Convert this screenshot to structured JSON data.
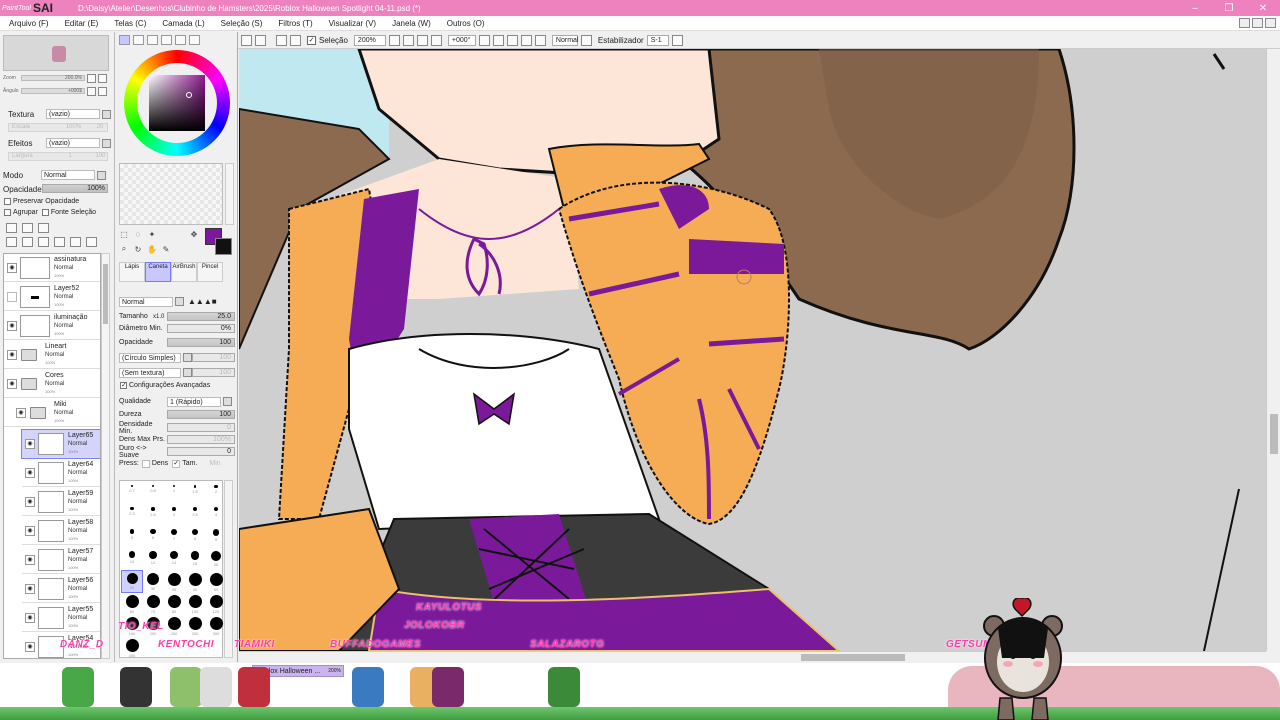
{
  "titlebar": {
    "logo_small": "PaintTool",
    "logo_big": "SAI",
    "title": "D:\\Daisy\\Atelier\\Desenhos\\Clubinho de Hamsters\\2025\\Roblox Halloween Spotlight 04-11.psd (*)",
    "min": "–",
    "max": "❐",
    "close": "✕"
  },
  "menu": {
    "items": [
      "Arquivo (F)",
      "Editar (E)",
      "Telas (C)",
      "Camada (L)",
      "Seleção (S)",
      "Filtros (T)",
      "Visualizar (V)",
      "Janela (W)",
      "Outros (O)"
    ]
  },
  "left": {
    "zoom_label": "Zoom",
    "zoom_value": "200.0%",
    "angle_label": "Ângulo",
    "angle_value": "+000$",
    "texture_label": "Textura",
    "texture_value": "(vazio)",
    "escala_label": "Escala",
    "escala_value": "100%",
    "escala_num": "20",
    "effects_label": "Efeitos",
    "effects_value": "(vazio)",
    "largura_label": "Largura",
    "largura_a": "1",
    "largura_b": "100",
    "mode_label": "Modo",
    "mode_value": "Normal",
    "opacity_label": "Opacidade",
    "opacity_value": "100%",
    "preserve_label": "Preservar Opacidade",
    "group_label": "Agrupar",
    "source_label": "Fonte Seleção"
  },
  "layers": [
    {
      "name": "assinatura",
      "mode": "Normal",
      "op": "100%",
      "type": "layer"
    },
    {
      "name": "Layer52",
      "mode": "Normal",
      "op": "100%",
      "type": "layer"
    },
    {
      "name": "iluminação",
      "mode": "Normal",
      "op": "100%",
      "type": "layer"
    },
    {
      "name": "Lineart",
      "mode": "Normal",
      "op": "100%",
      "type": "folder"
    },
    {
      "name": "Cores",
      "mode": "Normal",
      "op": "100%",
      "type": "folder"
    },
    {
      "name": "Miki",
      "mode": "Normal",
      "op": "100%",
      "type": "folder"
    },
    {
      "name": "Layer65",
      "mode": "Normal",
      "op": "100%",
      "type": "layer"
    },
    {
      "name": "Layer64",
      "mode": "Normal",
      "op": "100%",
      "type": "layer"
    },
    {
      "name": "Layer59",
      "mode": "Normal",
      "op": "100%",
      "type": "layer"
    },
    {
      "name": "Layer58",
      "mode": "Normal",
      "op": "100%",
      "type": "layer"
    },
    {
      "name": "Layer57",
      "mode": "Normal",
      "op": "100%",
      "type": "layer"
    },
    {
      "name": "Layer56",
      "mode": "Normal",
      "op": "100%",
      "type": "layer"
    },
    {
      "name": "Layer55",
      "mode": "Normal",
      "op": "100%",
      "type": "layer"
    },
    {
      "name": "Layer54",
      "mode": "Normal",
      "op": "100%",
      "type": "layer"
    }
  ],
  "tools": {
    "tabs": [
      "Lápis",
      "Caneta",
      "AirBrush",
      "Pincel"
    ],
    "blend_mode": "Normal",
    "size_label": "Tamanho",
    "size_mult": "x1.0",
    "size_value": "25.0",
    "min_diam_label": "Diâmetro Min.",
    "min_diam_value": "0%",
    "opacity_label": "Opacidade",
    "opacity_value": "100",
    "shape_value": "(Círculo Simples)",
    "shape_num": "100",
    "texture_value": "(Sem textura)",
    "texture_num": "100",
    "advanced_label": "Configurações Avançadas",
    "quality_label": "Qualidade",
    "quality_value": "1 (Rápido)",
    "hardness_label": "Dureza",
    "hardness_value": "100",
    "min_density_label": "Densidade Min.",
    "min_density_value": "0",
    "max_dens_label": "Dens Max Prs.",
    "max_dens_value": "100%",
    "hard_soft_label": "Duro <-> Suave",
    "hard_soft_value": "0",
    "press_label": "Press:",
    "dens_label": "Dens",
    "tam_label": "Tam.",
    "min_label": "Min"
  },
  "brush_sizes": [
    "0.7",
    "0.8",
    "1",
    "1.5",
    "2",
    "2.3",
    "2.6",
    "3",
    "3.5",
    "4",
    "5",
    "6",
    "7",
    "8",
    "9",
    "10",
    "12",
    "14",
    "16",
    "20",
    "25",
    "30",
    "35",
    "40",
    "50",
    "60",
    "70",
    "80",
    "100",
    "120",
    "160",
    "200",
    "250",
    "300",
    "350",
    "400"
  ],
  "toolbar2": {
    "selection_label": "Seleção",
    "zoom": "200%",
    "angle": "+000°",
    "blend": "Normal",
    "stabilizer_label": "Estabilizador",
    "stabilizer_value": "S-1"
  },
  "docbar": {
    "tab_label": "Roblox Halloween ...",
    "tab_zoom": "200%"
  },
  "overlay_names": [
    "DANZ_D",
    "TIO_KEL",
    "KENTOCHI",
    "TIAMIKI",
    "BUFFADOGAMES",
    "KAYULOTUS",
    "JOLOKOBR",
    "SALAZAROTG",
    "GETSUM"
  ],
  "colors": {
    "titlebar": "#ee82be",
    "accent_layer": "#d3d3fb",
    "purple": "#7a1a9a",
    "orange": "#f5ac55",
    "hair": "#8b6a50",
    "skin": "#fde6d8"
  }
}
